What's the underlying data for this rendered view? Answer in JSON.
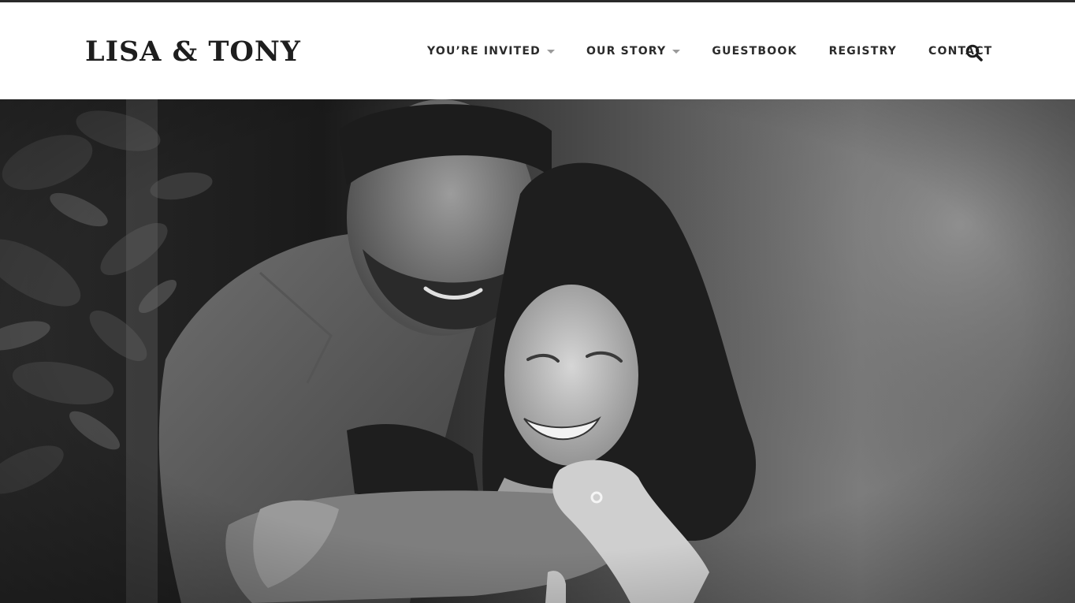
{
  "site": {
    "logo": "LISA & TONY"
  },
  "nav": {
    "items": [
      {
        "label": "YOU’RE INVITED",
        "has_dropdown": true
      },
      {
        "label": "OUR STORY",
        "has_dropdown": true
      },
      {
        "label": "GUESTBOOK",
        "has_dropdown": false
      },
      {
        "label": "REGISTRY",
        "has_dropdown": false
      },
      {
        "label": "CONTACT",
        "has_dropdown": false
      }
    ],
    "search_icon": "search-icon"
  },
  "hero": {
    "image": "hero-photo",
    "style": "black-and-white"
  },
  "colors": {
    "text_dark": "#2b2b2b",
    "caret": "#9a9a9a",
    "top_rule": "#2a2a2a"
  }
}
